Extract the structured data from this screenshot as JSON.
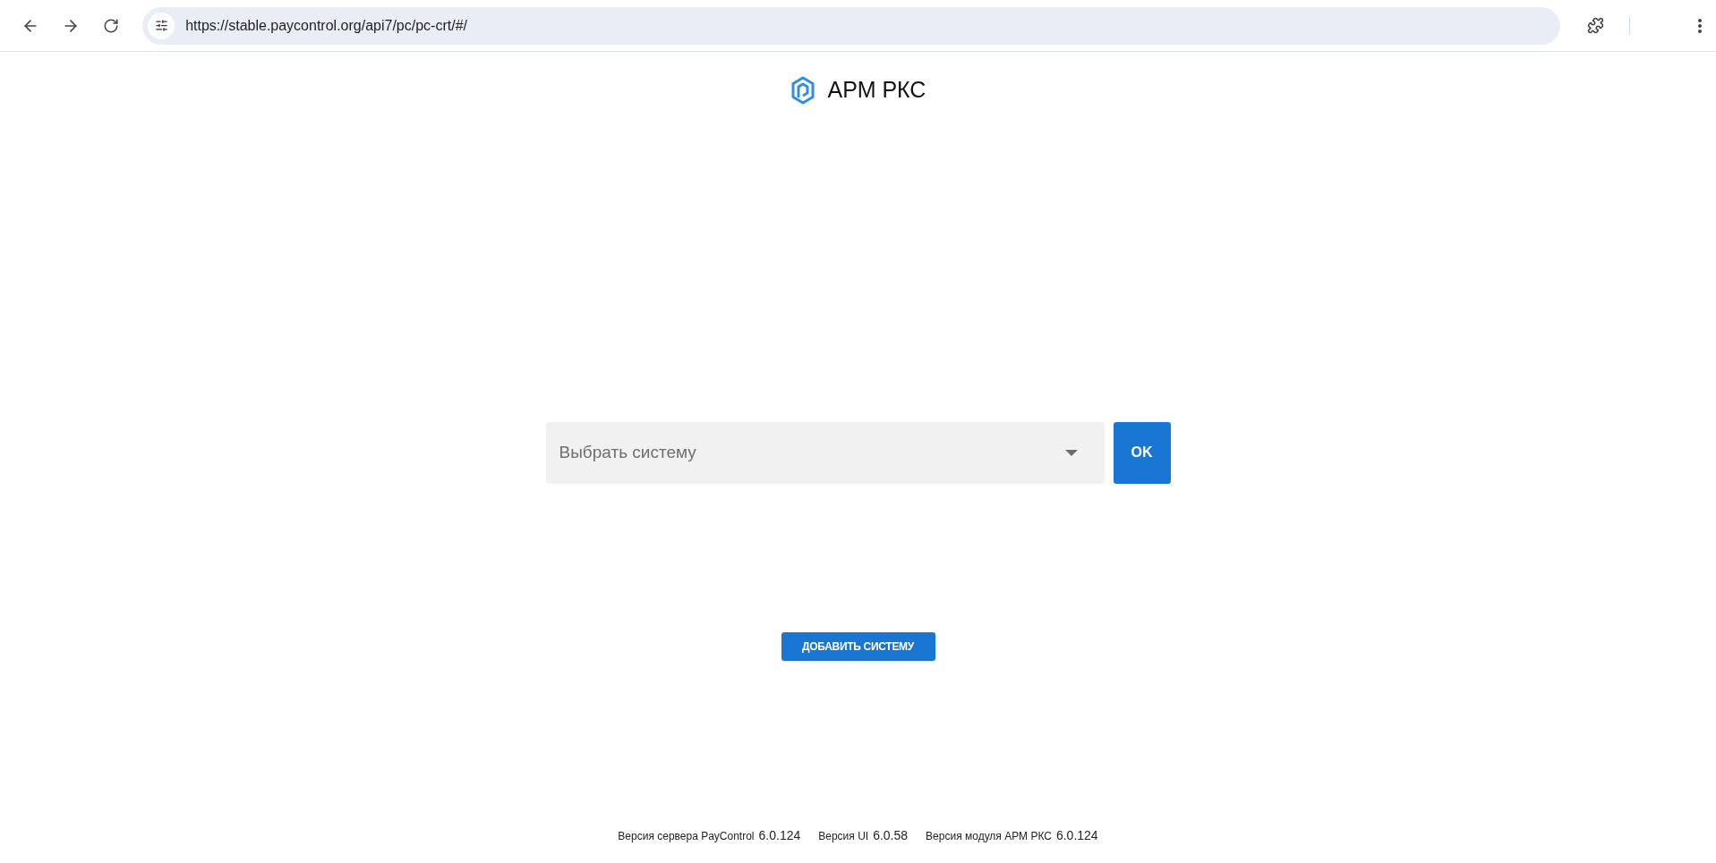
{
  "browser": {
    "url": "https://stable.paycontrol.org/api7/pc/pc-crt/#/"
  },
  "header": {
    "title": "АРМ РКС"
  },
  "system_select": {
    "placeholder": "Выбрать систему"
  },
  "ok_button": "OK",
  "add_button": "ДОБАВИТЬ СИСТЕМУ",
  "footer": [
    {
      "label": "Версия сервера PayControl",
      "version": "6.0.124"
    },
    {
      "label": "Версия UI",
      "version": "6.0.58"
    },
    {
      "label": "Версия модуля АРМ РКС",
      "version": "6.0.124"
    }
  ]
}
